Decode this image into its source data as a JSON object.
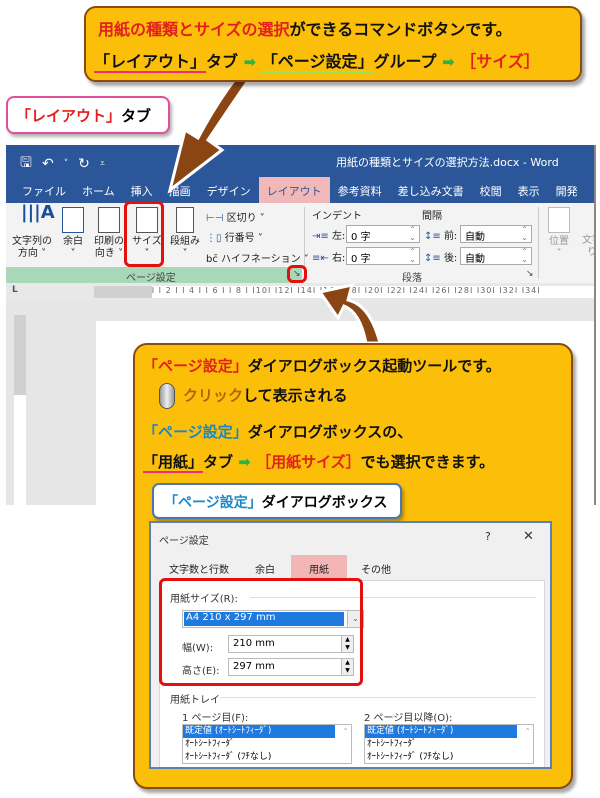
{
  "top_callout": {
    "line1_highlight": "用紙の種類とサイズの選択",
    "line1_rest": "ができるコマンドボタンです。",
    "line2_tab": "「レイアウト」",
    "line2_tab_suffix": "タブ",
    "arrow": "➡",
    "line2_group": "「ページ設定」",
    "line2_group_suffix": "グループ",
    "line2_button": "［サイズ］"
  },
  "layout_tab_label": {
    "highlight": "「レイアウト」",
    "suffix": "タブ"
  },
  "word": {
    "qat": {
      "save": "🖫",
      "undo": "↶",
      "undo_dropdown": "˅",
      "redo": "↻",
      "customize": "⩡"
    },
    "doc_title": "用紙の種類とサイズの選択方法.docx  -  Word",
    "tabs": [
      "ファイル",
      "ホーム",
      "挿入",
      "描画",
      "デザイン",
      "レイアウト",
      "参考資料",
      "差し込み文書",
      "校閲",
      "表示",
      "開発",
      "ヘルプ"
    ],
    "active_tab": "レイアウト",
    "ribbon": {
      "page_setup": {
        "text_direction": [
          "文字列の",
          "方向 ˅"
        ],
        "margins": [
          "余白",
          "˅"
        ],
        "orientation": [
          "印刷の",
          "向き ˅"
        ],
        "size": [
          "サイズ",
          "˅"
        ],
        "columns": [
          "段組み",
          "˅"
        ],
        "breaks": "区切り ˅",
        "line_numbers": "行番号 ˅",
        "hyphenation": "ハイフネーション ˅",
        "group_label": "ページ設定",
        "launcher": "↘"
      },
      "paragraph": {
        "indent_label": "インデント",
        "spacing_label": "間隔",
        "left_label": "左:",
        "left_value": "0 字",
        "right_label": "右:",
        "right_value": "0 字",
        "before_label": "前:",
        "before_value": "自動",
        "after_label": "後:",
        "after_value": "自動",
        "group_label": "段落",
        "launcher": "↘"
      },
      "arrange": {
        "position": [
          "位置",
          "˅"
        ],
        "wrap": [
          "文字",
          "り"
        ]
      }
    },
    "ruler": {
      "tab_selector": "L",
      "ticks": "I 4 I  I 2 I  I    I  I 2 I  I 4 I  I 6 I  I 8 I  I10I  I12I  I14I  I16I  I18I  I20I  I22I  I24I  I26I  I28I  I30I  I32I  I34I"
    }
  },
  "bottom_callout": {
    "line1_highlight": "「ページ設定」",
    "line1_rest": "ダイアログボックス起動ツールです。",
    "line2_click": "クリック",
    "line2_rest": "して表示される",
    "line3_highlight": "「ページ設定」",
    "line3_rest": "ダイアログボックスの、",
    "line4_tab": "「用紙」",
    "line4_tab_suffix": "タブ",
    "arrow": "➡",
    "line4_option": "［用紙サイズ］",
    "line4_rest": "でも選択できます。"
  },
  "dialog_label": {
    "highlight": "「ページ設定」",
    "suffix": "ダイアログボックス"
  },
  "dialog": {
    "title": "ページ設定",
    "help": "?",
    "close": "✕",
    "tabs": [
      "文字数と行数",
      "余白",
      "用紙",
      "その他"
    ],
    "active_tab": "用紙",
    "paper_size_label": "用紙サイズ(R):",
    "paper_size_value": "A4 210 x 297 mm",
    "width_label": "幅(W):",
    "width_value": "210 mm",
    "height_label": "高さ(E):",
    "height_value": "297 mm",
    "tray_label": "用紙トレイ",
    "first_page_label": "1 ページ目(F):",
    "other_pages_label": "2 ページ目以降(O):",
    "tray_options": [
      "既定値 (ｵｰﾄｼｰﾄﾌｨｰﾀﾞ)",
      "ｵｰﾄｼｰﾄﾌｨｰﾀﾞ",
      "ｵｰﾄｼｰﾄﾌｨｰﾀﾞ (ﾌﾁなし)"
    ]
  },
  "colors": {
    "callout_fill": "#fbbf0a",
    "callout_border": "#8a4a10",
    "word_blue": "#2b579a",
    "active_tab": "#f0b8b8",
    "highlight_red": "#e3201b",
    "highlight_blue": "#1c86c8",
    "selection_blue": "#1f7ae0"
  }
}
